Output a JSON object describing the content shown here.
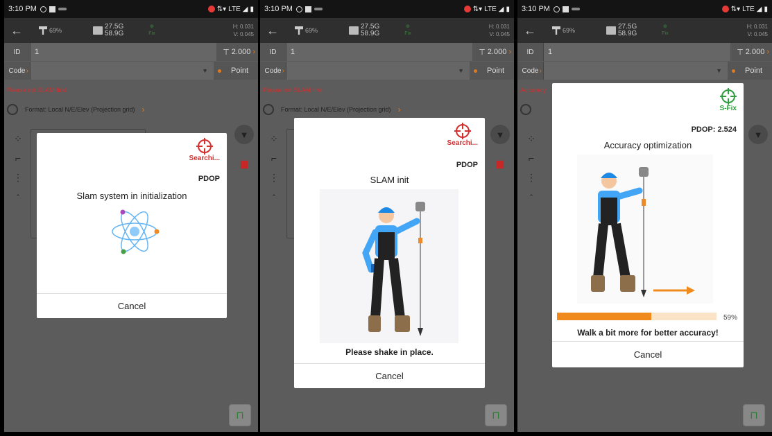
{
  "status": {
    "time": "3:10 PM",
    "network": "LTE"
  },
  "topbar": {
    "pole_pct": "69%",
    "storage_top": "27.5G",
    "storage_bottom": "58.9G",
    "fix": "Fix",
    "h_acc": "H: 0.031",
    "v_acc": "V: 0.045"
  },
  "fields": {
    "id_tag": "ID",
    "id_value": "1",
    "height": "2.000",
    "code_tag": "Code",
    "point_type": "Point"
  },
  "format_label": "Format: Local N/E/Elev (Projection grid)",
  "screens": [
    {
      "message": "Please init SLAM first",
      "status_label": "Searchi...",
      "pdop_label": "PDOP",
      "title": "Slam system in initialization",
      "cancel": "Cancel"
    },
    {
      "message": "Please init SLAM first",
      "status_label": "Searchi...",
      "pdop_label": "PDOP",
      "title": "SLAM init",
      "hint": "Please shake in place.",
      "cancel": "Cancel"
    },
    {
      "message": "Accuracy",
      "status_label": "S-Fix",
      "pdop_label": "PDOP:",
      "pdop_value": "2.524",
      "title": "Accuracy optimization",
      "progress": 0.59,
      "progress_text": "59%",
      "hint": "Walk a bit more for better accuracy!",
      "cancel": "Cancel"
    }
  ],
  "colors": {
    "accent": "#e07a20",
    "error": "#d32f2f",
    "fix_green": "#2e9e3e"
  }
}
